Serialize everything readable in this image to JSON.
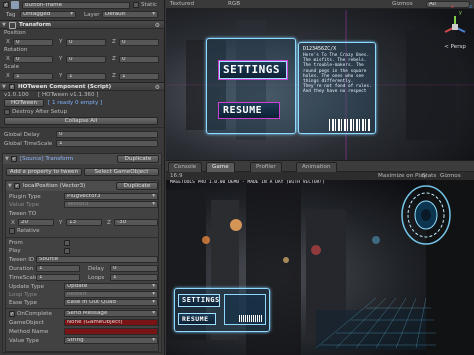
{
  "inspector": {
    "object_name": "button-frame",
    "static_label": "Static",
    "tag_label": "Tag",
    "tag_value": "Untagged",
    "layer_label": "Layer",
    "layer_value": "Default",
    "transform": {
      "title": "Transform",
      "position_label": "Position",
      "rotation_label": "Rotation",
      "scale_label": "Scale",
      "axis_x": "X",
      "axis_y": "Y",
      "axis_z": "Z",
      "position": [
        "0",
        "0",
        "0"
      ],
      "rotation": [
        "0",
        "0",
        "0"
      ],
      "scale": [
        "1",
        "1",
        "1"
      ]
    },
    "hotween": {
      "title": "HOTween Component (Script)",
      "version": "v1.0.100",
      "hotween_version": "[ HOTween v1.1.360 ]",
      "tab_hotween": "HOTween",
      "tab_status": "[ 1 ready  0 empty ]",
      "destroy_after_setup": "Destroy After Setup",
      "collapse_all": "Collapse All",
      "global_delay_label": "Global Delay",
      "global_delay": "0",
      "global_timescale_label": "Global TimeScale",
      "global_timescale": "1",
      "target_title": "[Source] Transform",
      "duplicate": "Duplicate",
      "add_property": "Add a property to tween",
      "select_gameobject": "Select GameObject",
      "prop_title": "localPosition (Vector3)",
      "plugin_type_label": "Plugin Type",
      "plugin_type_value": "PlugVector3",
      "value_type_label": "Value Type",
      "value_type_value": "Vector3",
      "tween_to_label": "Tween TO",
      "tween_to": [
        "20",
        "13",
        "-30"
      ],
      "relative_label": "Relative",
      "from_label": "From",
      "play_label": "Play",
      "tween_id_label": "Tween ID",
      "tween_id_value": "Source",
      "duration_label": "Duration",
      "duration_value": "1",
      "delay_label": "Delay",
      "delay_value": "0",
      "timescale_label": "TimeScale",
      "timescale_value": "1",
      "loops_label": "Loops",
      "loops_value": "1",
      "update_type_label": "Update Type",
      "update_type_value": "Update",
      "loop_type_label": "Loop Type",
      "loop_type_value": "Restart",
      "ease_type_label": "Ease Type",
      "ease_type_value": "Ease In Out Quad",
      "on_complete_label": "OnComplete",
      "on_complete_value": "Send Message",
      "gameobject_label": "GameObject",
      "gameobject_value": "None (GameObject)",
      "method_name_label": "Method Name",
      "value_type2_label": "Value Type",
      "value_type2_value": "String"
    }
  },
  "scene": {
    "mode": "Textured",
    "rgb": "RGB",
    "gizmos": "Gizmos",
    "search": "All",
    "persp": "< Persp",
    "gizmo_axes": [
      "x",
      "y",
      "z"
    ],
    "settings_button": "SETTINGS",
    "resume_button": "RESUME",
    "info_code": "D123456ZC/X",
    "info_text": "Here's To The Crazy Ones. The misfits. The rebels. The trouble-makers. The round pegs in the square holes. The ones who see things differently. They're not fond of rules. And they have no respect"
  },
  "tabs": {
    "console": "Console",
    "game": "Game",
    "profiler": "Profiler",
    "animation": "Animation"
  },
  "game": {
    "aspect": "16:9",
    "maximize": "Maximize on Play",
    "stats": "Stats",
    "gizmos": "Gizmos",
    "credit": "MAGETOOLS PRO 1.0.00 DEMO - MADE IN A DAY (WITH VECTOR!)",
    "settings_button": "SETTINGS",
    "resume_button": "RESUME"
  },
  "colors": {
    "accent_blue": "#3a6fb0",
    "panel_cyan": "#8fd8ff",
    "method_field_red": "#7a1414"
  },
  "icons": [
    "cube-icon",
    "transform-icon",
    "script-icon",
    "gear-icon",
    "eye-icon",
    "scene-gizmo-icon",
    "portal-ring-icon",
    "barcode-icon"
  ]
}
